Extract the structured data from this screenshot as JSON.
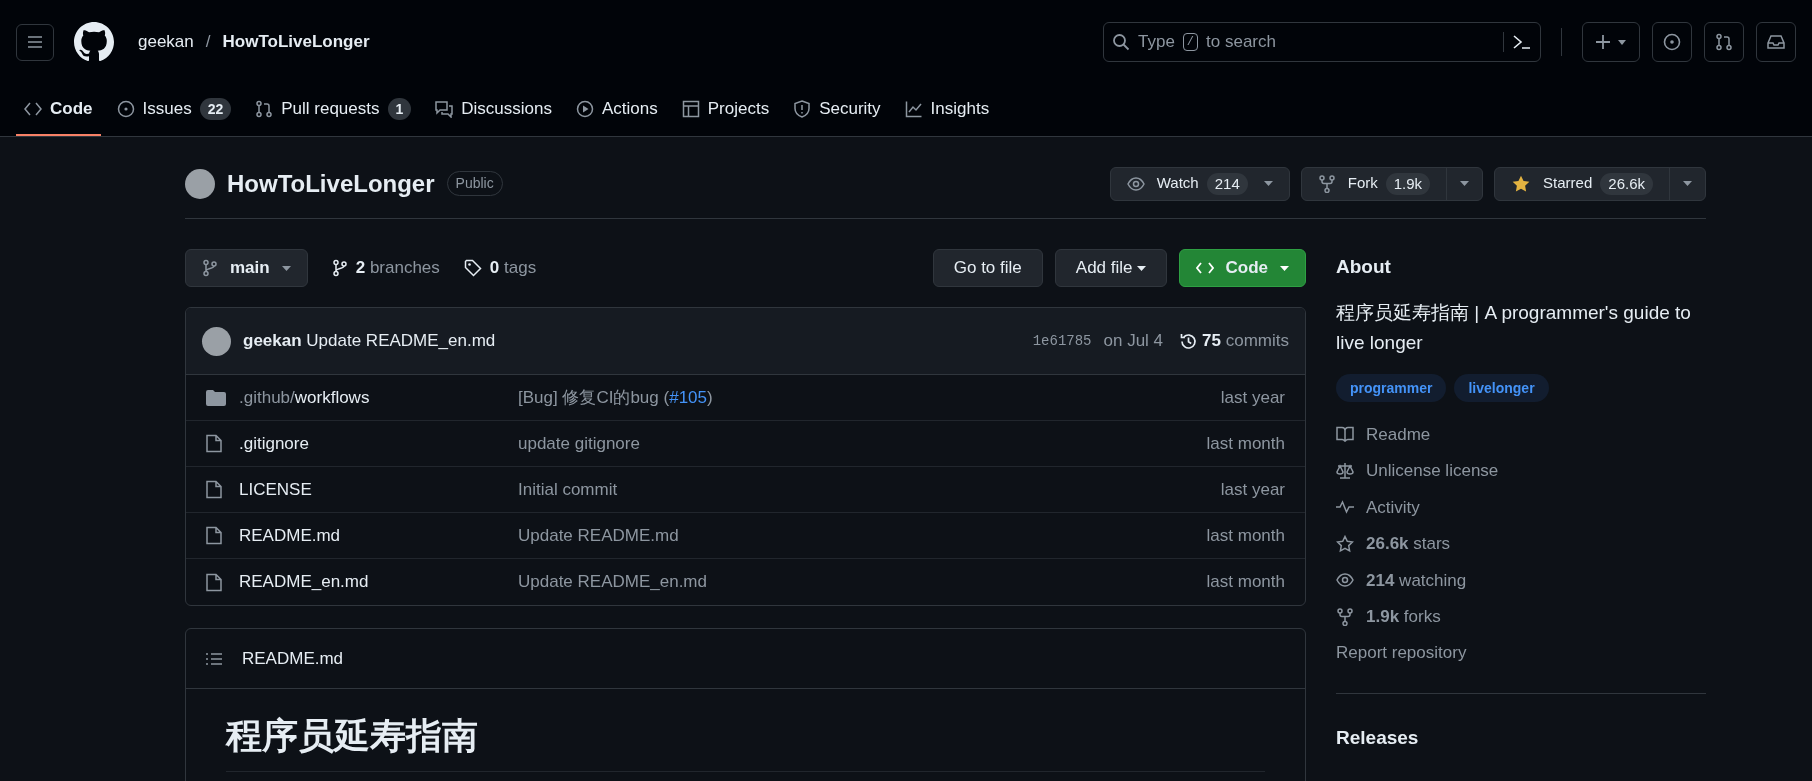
{
  "header": {
    "owner": "geekan",
    "separator": "/",
    "repo": "HowToLiveLonger",
    "search_placeholder_parts": [
      "Type",
      "/",
      "to search"
    ]
  },
  "tabs": [
    {
      "label": "Code",
      "kind": "code",
      "selected": true
    },
    {
      "label": "Issues",
      "kind": "issues",
      "count": "22",
      "selected": false
    },
    {
      "label": "Pull requests",
      "kind": "pulls",
      "count": "1",
      "selected": false
    },
    {
      "label": "Discussions",
      "kind": "discussions",
      "selected": false
    },
    {
      "label": "Actions",
      "kind": "actions",
      "selected": false
    },
    {
      "label": "Projects",
      "kind": "projects",
      "selected": false
    },
    {
      "label": "Security",
      "kind": "security",
      "selected": false
    },
    {
      "label": "Insights",
      "kind": "insights",
      "selected": false
    }
  ],
  "repo": {
    "name": "HowToLiveLonger",
    "visibility": "Public",
    "actions": [
      {
        "kind": "watch",
        "label": "Watch",
        "count": "214"
      },
      {
        "kind": "fork",
        "label": "Fork",
        "count": "1.9k"
      },
      {
        "kind": "star",
        "label": "Starred",
        "count": "26.6k"
      }
    ]
  },
  "branch_bar": {
    "branch": "main",
    "branches_count": "2",
    "branches_label": "branches",
    "tags_count": "0",
    "tags_label": "tags",
    "go_to_file": "Go to file",
    "add_file": "Add file",
    "code": "Code"
  },
  "latest_commit": {
    "author": "geekan",
    "message": "Update README_en.md",
    "sha": "1e61785",
    "date": "on Jul 4",
    "commits_count": "75",
    "commits_label": "commits"
  },
  "files": [
    {
      "kind": "folder",
      "prefix": ".github/",
      "name": "workflows",
      "message": "[Bug] 修复CI的bug (",
      "link": "#105",
      "message_end": ")",
      "time": "last year"
    },
    {
      "kind": "file",
      "name": ".gitignore",
      "message": "update gitignore",
      "time": "last month"
    },
    {
      "kind": "file",
      "name": "LICENSE",
      "message": "Initial commit",
      "time": "last year"
    },
    {
      "kind": "file",
      "name": "README.md",
      "message": "Update README.md",
      "time": "last month"
    },
    {
      "kind": "file",
      "name": "README_en.md",
      "message": "Update README_en.md",
      "time": "last month"
    }
  ],
  "readme": {
    "filename": "README.md",
    "heading": "程序员延寿指南"
  },
  "about": {
    "title": "About",
    "description": "程序员延寿指南 | A programmer's guide to live longer",
    "topics": [
      "programmer",
      "livelonger"
    ],
    "items": [
      {
        "kind": "readme",
        "label": "Readme"
      },
      {
        "kind": "license",
        "label": "Unlicense license"
      },
      {
        "kind": "activity",
        "label": "Activity"
      },
      {
        "kind": "stars",
        "count": "26.6k",
        "label": "stars"
      },
      {
        "kind": "watchers",
        "count": "214",
        "label": "watching"
      },
      {
        "kind": "forks",
        "count": "1.9k",
        "label": "forks"
      }
    ],
    "report": "Report repository",
    "releases": "Releases"
  }
}
